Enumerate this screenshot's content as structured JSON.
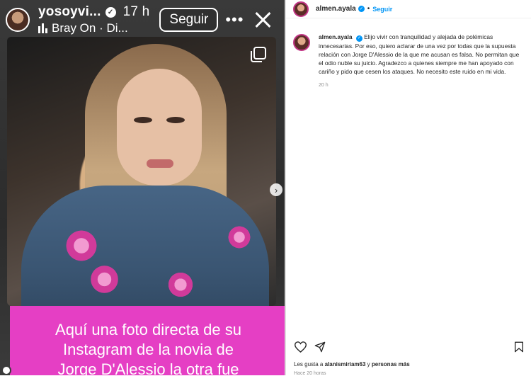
{
  "story": {
    "username": "yosoyvi...",
    "time": "17 h",
    "music": "Bray On · Di...",
    "follow_label": "Seguir",
    "more_label": "•••",
    "caption_lines": [
      "Aquí una foto directa de su",
      "Instagram de la novia de",
      "Jorge D'Alessio la otra fue"
    ]
  },
  "post": {
    "username": "almen.ayala",
    "follow_label": "Seguir",
    "caption_username": "almen.ayala",
    "caption_text": "Elijo vivir con tranquilidad y alejada de polémicas innecesarias. Por eso, quiero aclarar de una vez por todas que la supuesta relación con Jorge D'Alessio de la que me acusan es falsa. No permitan que el odio nuble su juicio. Agradezco a quienes siempre me han apoyado con cariño y pido que cesen los ataques. No necesito este ruido en mi vida.",
    "caption_time": "20 h",
    "likes_prefix": "Les gusta a",
    "likes_user": "alanismiriam63",
    "likes_suffix": "y",
    "likes_others": "personas más",
    "ago": "Hace 20 horas"
  },
  "icons": {
    "story_verified": "verified-badge-icon",
    "music": "music-bars-icon",
    "close": "close-icon",
    "multi": "multiple-images-icon",
    "next": "chevron-right-icon",
    "heart": "heart-icon",
    "share": "share-icon",
    "bookmark": "bookmark-icon"
  },
  "colors": {
    "caption_bg": "#e53fc4",
    "follow_blue": "#0095f6",
    "verified_blue": "#0095f6"
  }
}
